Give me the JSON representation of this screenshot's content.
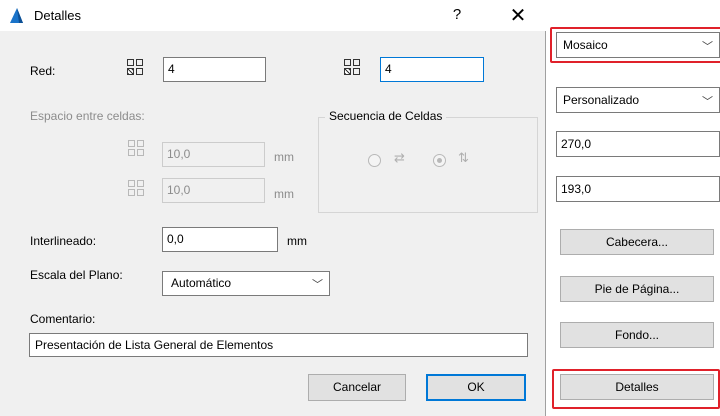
{
  "dialog": {
    "title": "Detalles",
    "help": "?",
    "close": "✕",
    "red": {
      "label": "Red:",
      "cols": "4",
      "rows": "4"
    },
    "spacing": {
      "label": "Espacio entre celdas:",
      "horizontal": "10,0",
      "vertical": "10,0",
      "unit": "mm"
    },
    "sequence": {
      "title": "Secuencia de Celdas",
      "options": [
        "horizontal",
        "vertical"
      ],
      "selected": "vertical"
    },
    "interlineado": {
      "label": "Interlineado:",
      "value": "0,0",
      "unit": "mm"
    },
    "escala": {
      "label": "Escala del Plano:",
      "value": "Automático"
    },
    "comentario": {
      "label": "Comentario:",
      "value": "Presentación de Lista General de Elementos"
    },
    "buttons": {
      "cancel": "Cancelar",
      "ok": "OK"
    }
  },
  "panel": {
    "mosaico": "Mosaico",
    "personalizado": "Personalizado",
    "width": "270,0",
    "height": "193,0",
    "cabecera": "Cabecera...",
    "pie": "Pie de Página...",
    "fondo": "Fondo...",
    "detalles": "Detalles"
  },
  "colors": {
    "accent": "#0078d7",
    "highlight": "#e0212a",
    "dialog_bg": "#f0f0f0"
  },
  "icons": {
    "title": "archicad-logo-icon",
    "grid": "grid-icon",
    "chevron": "chevron-down-icon"
  }
}
